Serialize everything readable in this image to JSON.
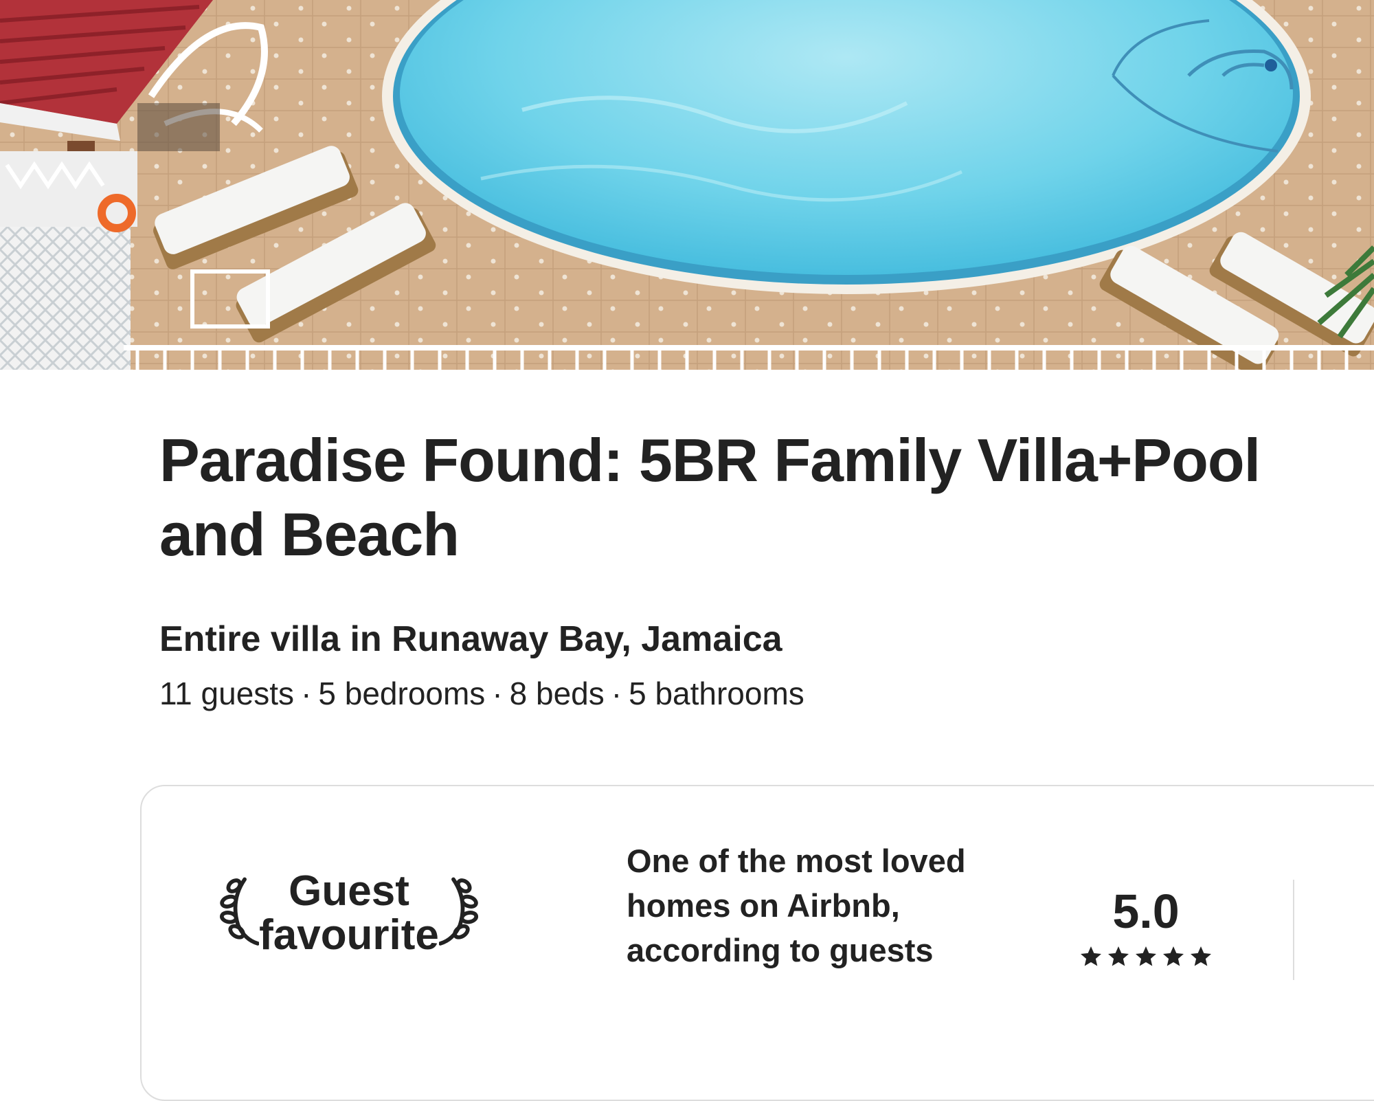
{
  "hero_photo": {
    "icon": "pool-photo",
    "alt_colors": {
      "water": "#5fd0ea",
      "deck": "#d4b18d",
      "roof": "#b5303a"
    }
  },
  "listing": {
    "title": "Paradise Found: 5BR Family Villa+Pool and Beach",
    "subtitle": "Entire villa in Runaway Bay, Jamaica",
    "specs": {
      "guests": "11 guests",
      "bedrooms": "5 bedrooms",
      "beds": "8 beds",
      "bathrooms": "5 bathrooms",
      "separator": "·"
    }
  },
  "guest_favourite": {
    "badge_line1": "Guest",
    "badge_line2": "favourite",
    "description": "One of the most loved homes on Airbnb, according to guests",
    "rating": "5.0",
    "stars": 5,
    "icons": {
      "left": "laurel-left-icon",
      "right": "laurel-right-icon",
      "star": "star-icon"
    }
  },
  "colors": {
    "text": "#222222",
    "border": "#dddddd"
  }
}
